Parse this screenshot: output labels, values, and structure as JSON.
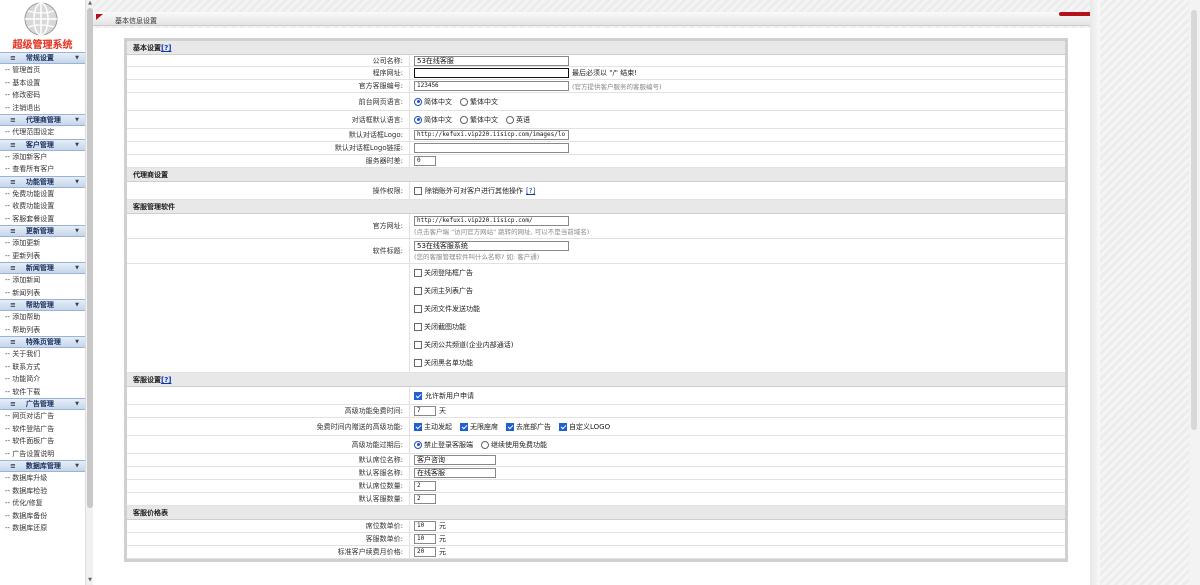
{
  "app": {
    "logo_text": "超级管理系统"
  },
  "sidebar": {
    "groups": [
      {
        "title": "常规设置",
        "items": [
          "管理首页",
          "基本设置",
          "修改密码",
          "注销退出"
        ]
      },
      {
        "title": "代理商管理",
        "items": [
          "代理范围设定"
        ]
      },
      {
        "title": "客户管理",
        "items": [
          "添加新客户",
          "查看所有客户"
        ]
      },
      {
        "title": "功能管理",
        "items": [
          "免费功能设置",
          "收费功能设置",
          "客服套餐设置"
        ]
      },
      {
        "title": "更新管理",
        "items": [
          "添加更新",
          "更新列表"
        ]
      },
      {
        "title": "新闻管理",
        "items": [
          "添加新闻",
          "新闻列表"
        ]
      },
      {
        "title": "帮助管理",
        "items": [
          "添加帮助",
          "帮助列表"
        ]
      },
      {
        "title": "特殊页管理",
        "items": [
          "关于我们",
          "联系方式",
          "功能简介",
          "软件下载"
        ]
      },
      {
        "title": "广告管理",
        "items": [
          "网页对话广告",
          "软件登陆广告",
          "软件面板广告",
          "广告设置说明"
        ]
      },
      {
        "title": "数据库管理",
        "items": [
          "数据库升级",
          "数据库检验",
          "优化/修复",
          "数据库备份",
          "数据库还原"
        ]
      }
    ],
    "item_prefix": "-- "
  },
  "header": {
    "tab_title": "基本信息设置"
  },
  "content": {
    "basic": {
      "section_title": "基本设置",
      "help_mark": "[?]",
      "company_label": "公司名称:",
      "company_value": "53在线客服",
      "program_url_label": "程序网址:",
      "program_url_value": "",
      "program_url_hint": "最后必须以 \"/\" 结束!",
      "official_id_label": "官方客服编号:",
      "official_id_value": "123456",
      "official_id_hint": "(官方提供客户服务的客服编号)",
      "front_lang_label": "前台网页语言:",
      "front_lang_options": [
        "简体中文",
        "繁体中文"
      ],
      "dialog_lang_label": "对话框默认语言:",
      "dialog_lang_options": [
        "简体中文",
        "繁体中文",
        "英语"
      ],
      "logo_label": "默认对话框Logo:",
      "logo_value": "http://kefuxi.vip220.iisicp.com/images/lo",
      "logo_link_label": "默认对话框Logo链接:",
      "logo_link_value": "",
      "timezone_label": "服务器时差:",
      "timezone_value": "0"
    },
    "agent": {
      "section_title": "代理商设置",
      "permission_label": "操作权限:",
      "permission_text": "除销账外可对客户进行其他操作",
      "permission_help": "[?]"
    },
    "software": {
      "section_title": "客服管理软件",
      "site_label": "官方网址:",
      "site_value": "http://kefuxi.vip220.iisicp.com/",
      "site_hint": "(点击客户端 \"访问官方网站\" 跳转的网址, 可以不是当前域名)",
      "title_label": "软件标题:",
      "title_value": "53在线客服系统",
      "title_hint": "(您的客服管理软件叫什么名称? 如: 客户通)",
      "checks": [
        "关闭登陆框广告",
        "关闭主列表广告",
        "关闭文件发送功能",
        "关闭截图功能",
        "关闭公共频道(企业内部通话)",
        "关闭黑名单功能"
      ]
    },
    "service": {
      "section_title": "客服设置",
      "help_mark": "[?]",
      "allow_new": "允许新用户申请",
      "trial_label": "高级功能免费时间:",
      "trial_value": "7",
      "trial_unit": "天",
      "gift_label": "免费时间内赠送的高级功能:",
      "gift_options": [
        "主动发起",
        "无限座席",
        "去底部广告",
        "自定义LOGO"
      ],
      "expire_label": "高级功能过期后:",
      "expire_options": [
        "禁止登录客服端",
        "继续使用免费功能"
      ],
      "seat_name_label": "默认席位名称:",
      "seat_name_value": "客户咨询",
      "agent_name_label": "默认客服名称:",
      "agent_name_value": "在线客服",
      "seat_count_label": "默认席位数量:",
      "seat_count_value": "2",
      "agent_count_label": "默认客服数量:",
      "agent_count_value": "2"
    },
    "price": {
      "section_title": "客服价格表",
      "seat_price_label": "席位数单价:",
      "seat_price_value": "10",
      "agent_price_label": "客服数单价:",
      "agent_price_value": "10",
      "renew_label": "标准客户续费月价格:",
      "renew_value": "20",
      "unit": "元"
    }
  }
}
